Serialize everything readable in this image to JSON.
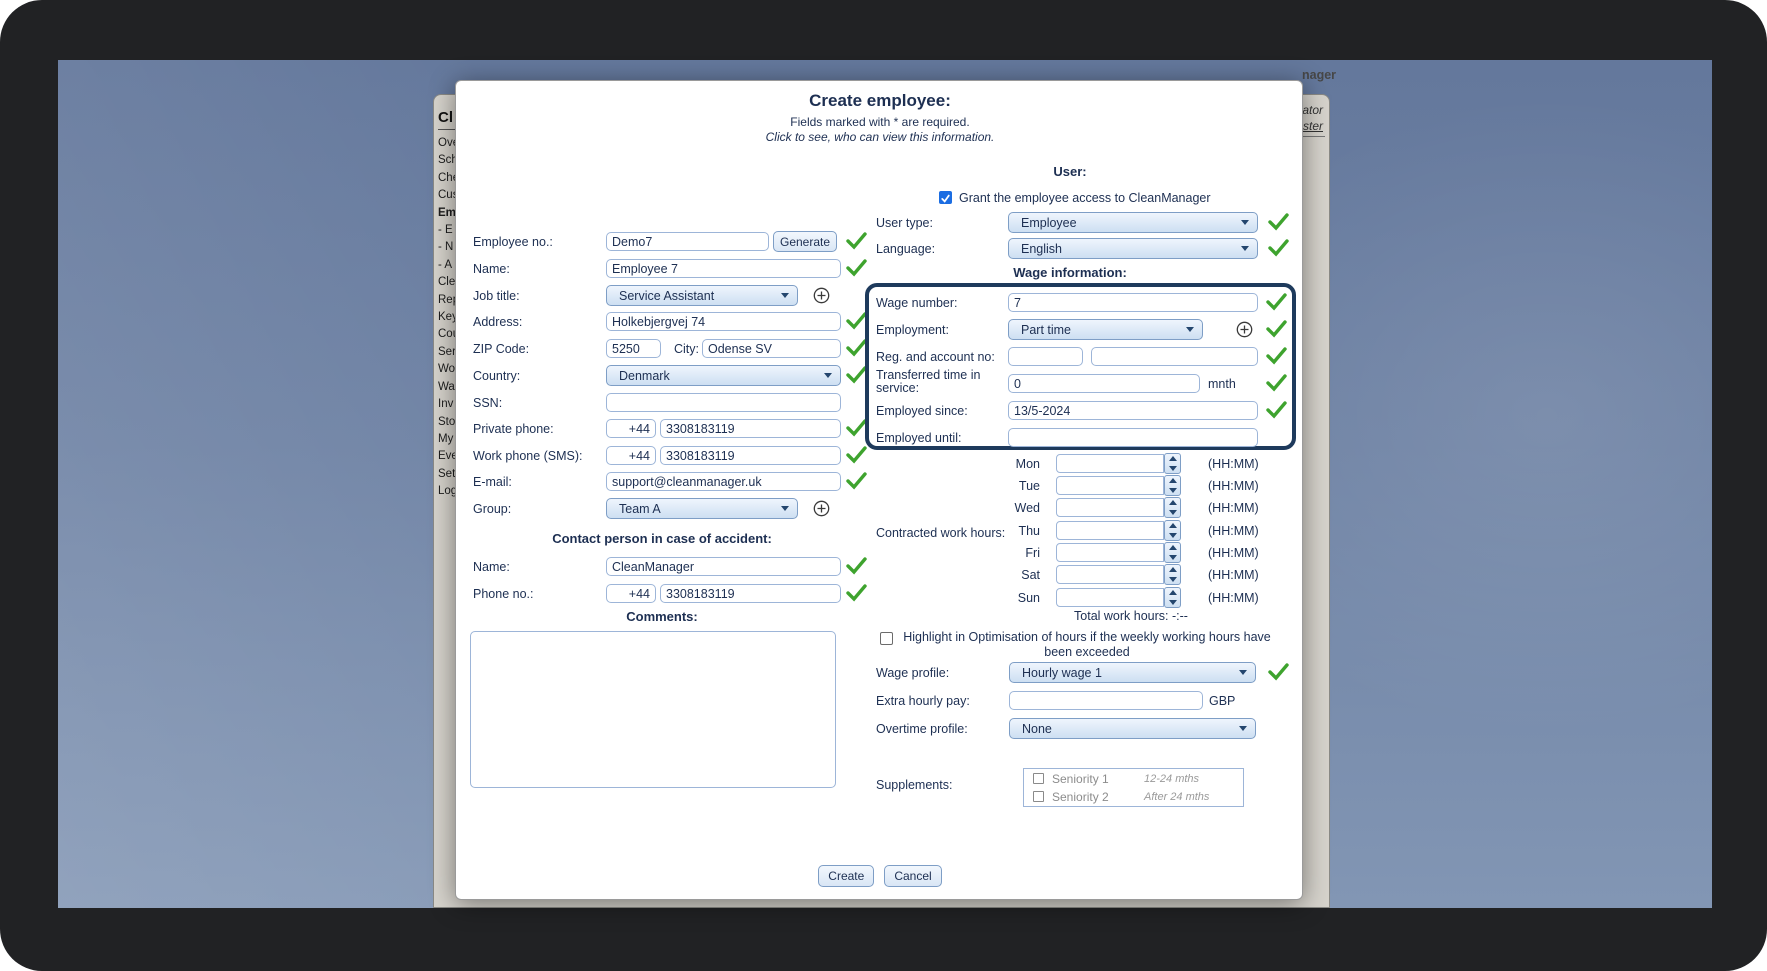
{
  "background": {
    "logo_fragment": "nager",
    "panel": {
      "admin_fragment": "ator",
      "user_fragment": "ster"
    },
    "sidebar": {
      "heading": "Cl",
      "items": [
        "Ove",
        "Sch",
        "Che",
        "Cus",
        "Em",
        "- E",
        "- N",
        "- A",
        "Cle",
        "Rep",
        "Key",
        "Cou",
        "Ser",
        "Wo",
        "Wa",
        "Inv",
        "Sto",
        "My",
        "Eve",
        "Set",
        "Log"
      ]
    }
  },
  "modal": {
    "title": "Create employee:",
    "required_note": "Fields marked with * are required.",
    "view_note": "Click to see, who can view this information.",
    "left": {
      "employee_no": {
        "label": "Employee no.:",
        "value": "Demo7",
        "generate_label": "Generate"
      },
      "name": {
        "label": "Name:",
        "value": "Employee 7"
      },
      "job_title": {
        "label": "Job title:",
        "value": "Service Assistant"
      },
      "address": {
        "label": "Address:",
        "value": "Holkebjergvej 74"
      },
      "zip": {
        "label": "ZIP Code:",
        "value": "5250",
        "city_label": "City:",
        "city_value": "Odense SV"
      },
      "country": {
        "label": "Country:",
        "value": "Denmark"
      },
      "ssn": {
        "label": "SSN:",
        "value": ""
      },
      "private_phone": {
        "label": "Private phone:",
        "prefix": "+44",
        "value": "3308183119"
      },
      "work_phone": {
        "label": "Work phone (SMS):",
        "prefix": "+44",
        "value": "3308183119"
      },
      "email": {
        "label": "E-mail:",
        "value": "support@cleanmanager.uk"
      },
      "group": {
        "label": "Group:",
        "value": "Team A"
      },
      "contact_header": "Contact person in case of accident:",
      "contact_name": {
        "label": "Name:",
        "value": "CleanManager"
      },
      "contact_phone": {
        "label": "Phone no.:",
        "prefix": "+44",
        "value": "3308183119"
      },
      "comments_header": "Comments:",
      "comments_value": ""
    },
    "user": {
      "header": "User:",
      "grant_label": "Grant the employee access to CleanManager",
      "grant_checked": true,
      "user_type": {
        "label": "User type:",
        "value": "Employee"
      },
      "language": {
        "label": "Language:",
        "value": "English"
      }
    },
    "wage": {
      "header": "Wage information:",
      "wage_number": {
        "label": "Wage number:",
        "value": "7"
      },
      "employment": {
        "label": "Employment:",
        "value": "Part time"
      },
      "reg_account": {
        "label": "Reg. and account no:",
        "reg_value": "",
        "account_value": ""
      },
      "transferred": {
        "label": "Transferred time in service:",
        "value": "0",
        "unit": "mnth"
      },
      "employed_since": {
        "label": "Employed since:",
        "value": "13/5-2024"
      },
      "employed_until": {
        "label": "Employed until:",
        "value": ""
      }
    },
    "hours": {
      "label": "Contracted work hours:",
      "days": [
        "Mon",
        "Tue",
        "Wed",
        "Thu",
        "Fri",
        "Sat",
        "Sun"
      ],
      "format_hint": "(HH:MM)",
      "total": "Total work hours: -:--",
      "highlight_label": "Highlight in Optimisation of hours if the weekly working hours have been exceeded",
      "highlight_checked": false
    },
    "pay": {
      "wage_profile": {
        "label": "Wage profile:",
        "value": "Hourly wage 1"
      },
      "extra_hourly": {
        "label": "Extra hourly pay:",
        "value": "",
        "currency": "GBP"
      },
      "overtime": {
        "label": "Overtime profile:",
        "value": "None"
      },
      "supplements_label": "Supplements:",
      "supplements": [
        {
          "label": "Seniority 1",
          "note": "12-24 mths",
          "checked": false
        },
        {
          "label": "Seniority 2",
          "note": "After 24 mths",
          "checked": false
        }
      ]
    },
    "buttons": {
      "create": "Create",
      "cancel": "Cancel"
    }
  },
  "colors": {
    "page_blue": "#6e82a4",
    "panel_gray": "#d6d3cc",
    "text_navy": "#1d2f52",
    "check_green": "#3ea32e",
    "highlight_box_border": "#1e3a5c",
    "checked_checkbox_blue": "#1b6de2",
    "frame_dark": "#212224"
  }
}
